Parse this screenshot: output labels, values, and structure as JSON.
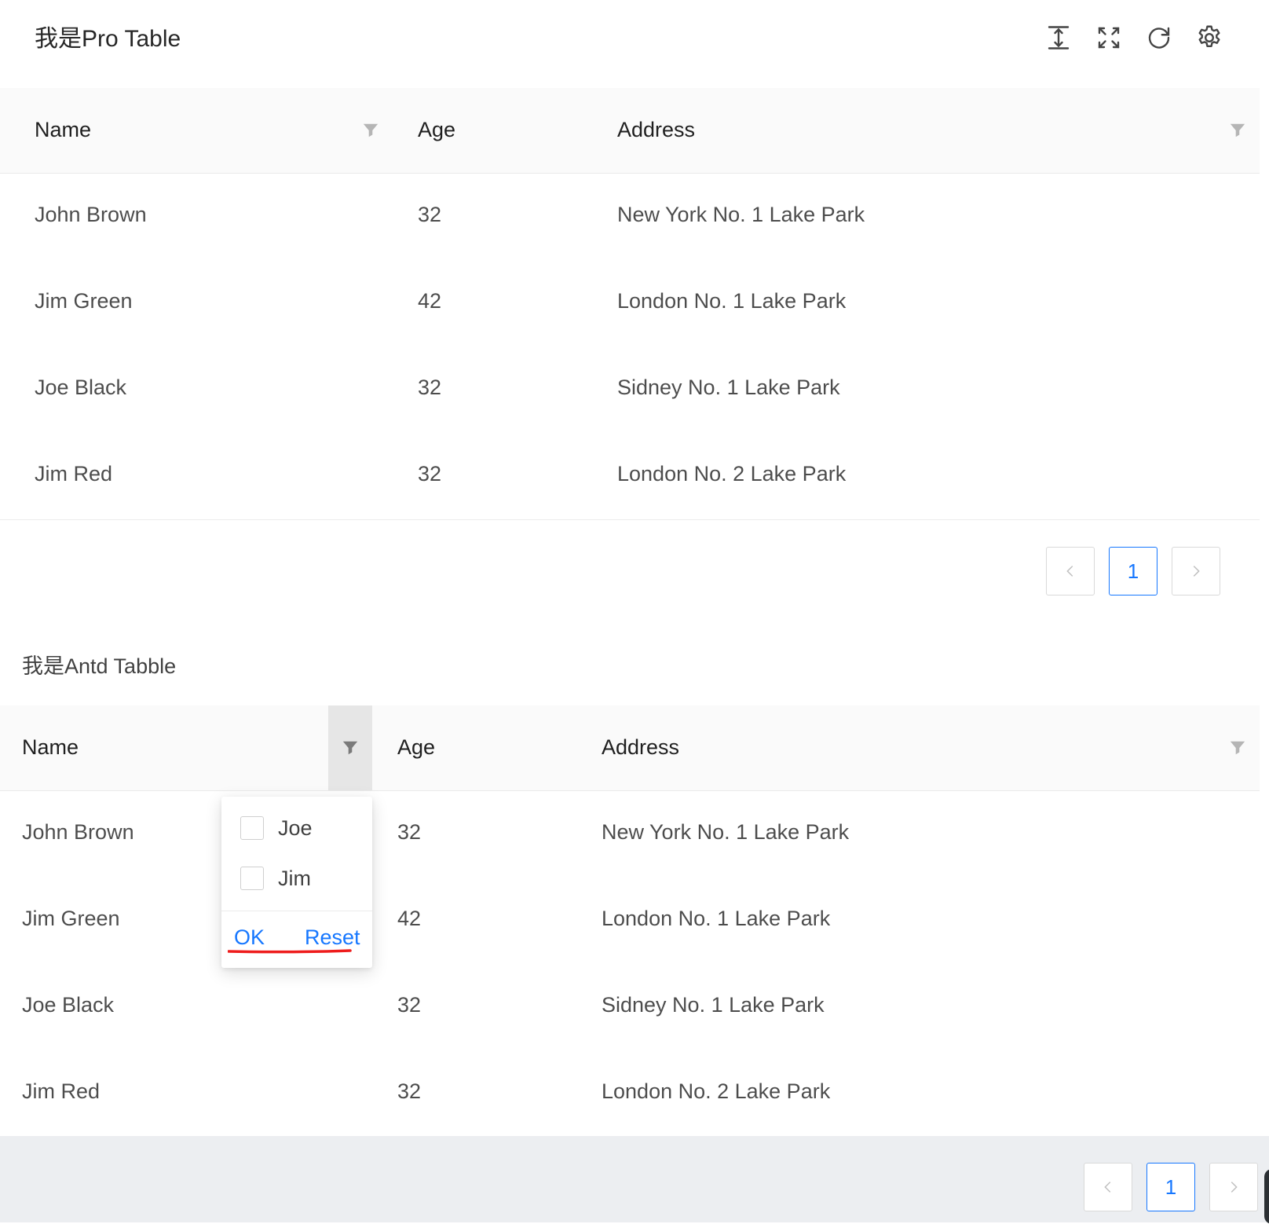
{
  "pro_table": {
    "title": "我是Pro Table",
    "toolbar": {
      "density_icon": "column-height-icon",
      "fullscreen_icon": "fullscreen-icon",
      "reload_icon": "reload-icon",
      "settings_icon": "setting-icon"
    },
    "columns": [
      "Name",
      "Age",
      "Address"
    ],
    "rows": [
      {
        "name": "John Brown",
        "age": "32",
        "address": "New York No. 1 Lake Park"
      },
      {
        "name": "Jim Green",
        "age": "42",
        "address": "London No. 1 Lake Park"
      },
      {
        "name": "Joe Black",
        "age": "32",
        "address": "Sidney No. 1 Lake Park"
      },
      {
        "name": "Jim Red",
        "age": "32",
        "address": "London No. 2 Lake Park"
      }
    ],
    "pagination": {
      "current_page": "1"
    }
  },
  "antd_table": {
    "title": "我是Antd Tabble",
    "columns": [
      "Name",
      "Age",
      "Address"
    ],
    "rows": [
      {
        "name": "John Brown",
        "age": "32",
        "address": "New York No. 1 Lake Park"
      },
      {
        "name": "Jim Green",
        "age": "42",
        "address": "London No. 1 Lake Park"
      },
      {
        "name": "Joe Black",
        "age": "32",
        "address": "Sidney No. 1 Lake Park"
      },
      {
        "name": "Jim Red",
        "age": "32",
        "address": "London No. 2 Lake Park"
      }
    ],
    "pagination": {
      "current_page": "1"
    }
  },
  "filter_dropdown": {
    "options": [
      {
        "label": "Joe",
        "checked": false
      },
      {
        "label": "Jim",
        "checked": false
      }
    ],
    "ok_label": "OK",
    "reset_label": "Reset"
  },
  "colors": {
    "primary": "#1677ff",
    "annotation": "#ee1c1c",
    "header_bg": "#fafafa",
    "footer_bg": "#eceef1"
  }
}
